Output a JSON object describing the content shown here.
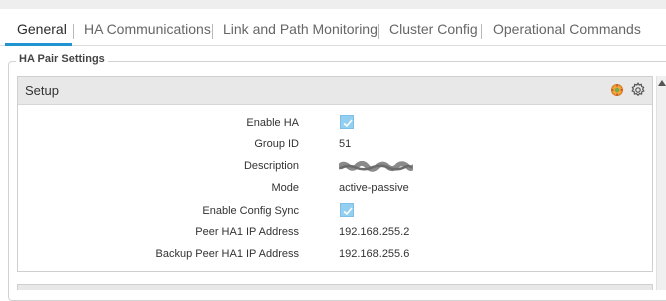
{
  "tabs": [
    {
      "label": "General",
      "active": true
    },
    {
      "label": "HA Communications",
      "active": false
    },
    {
      "label": "Link and Path Monitoring",
      "active": false
    },
    {
      "label": "Cluster Config",
      "active": false
    },
    {
      "label": "Operational Commands",
      "active": false
    }
  ],
  "group": {
    "legend": "HA Pair Settings"
  },
  "setup": {
    "title": "Setup",
    "icons": [
      "ping-status-icon",
      "gear-icon"
    ],
    "fields": {
      "enable_ha": {
        "label": "Enable HA",
        "checked": true
      },
      "group_id": {
        "label": "Group ID",
        "value": "51"
      },
      "description": {
        "label": "Description",
        "value_redacted": true
      },
      "mode": {
        "label": "Mode",
        "value": "active-passive"
      },
      "enable_config_sync": {
        "label": "Enable Config Sync",
        "checked": true
      },
      "peer_ha1_ip": {
        "label": "Peer HA1 IP Address",
        "value": "192.168.255.2"
      },
      "backup_peer_ha1_ip": {
        "label": "Backup Peer HA1 IP Address",
        "value": "192.168.255.6"
      }
    }
  },
  "colors": {
    "accent": "#1f94d1",
    "checkbox": "#92cff0",
    "panel_header": "#e8e8e8"
  }
}
